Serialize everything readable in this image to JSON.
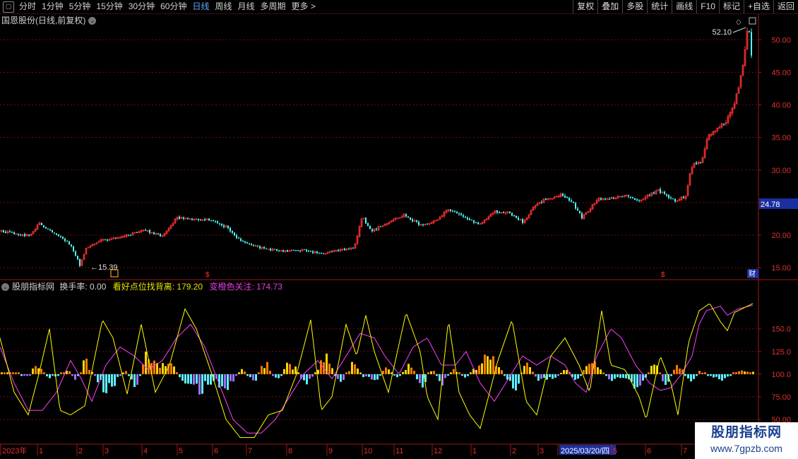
{
  "toolbar": {
    "periods": [
      "分时",
      "1分钟",
      "5分钟",
      "15分钟",
      "30分钟",
      "60分钟",
      "日线",
      "周线",
      "月线",
      "多周期",
      "更多 >"
    ],
    "active_period": "日线",
    "right_buttons": [
      "复权",
      "叠加",
      "多股",
      "统计",
      "画线",
      "F10",
      "标记",
      "+自选",
      "返回"
    ]
  },
  "stock_title": "国恩股份(日线,前复权)",
  "indicator": {
    "name": "股朋指标网",
    "turnover_label": "换手率: 0.00",
    "line1_label": "看好点位找背离: 179.20",
    "line2_label": "变橙色关注: 174.73"
  },
  "price_axis": {
    "ticks": [
      "50.00",
      "45.00",
      "40.00",
      "35.00",
      "30.00",
      "25.00",
      "20.00",
      "15.00"
    ],
    "current_price": "24.78",
    "ymin": 13.5,
    "ymax": 53.5
  },
  "indicator_axis": {
    "ticks": [
      "150.0",
      "125.0",
      "100.0",
      "75.00",
      "50.00"
    ],
    "ymin": 25,
    "ymax": 195
  },
  "annotations": {
    "high_label": "52.10",
    "low_label": "15.39",
    "cai_label": "财"
  },
  "time_axis": {
    "labels": [
      "2023年",
      "1",
      "2",
      "3",
      "4",
      "5",
      "6",
      "7",
      "8",
      "9",
      "10",
      "11",
      "12",
      "1",
      "2",
      "3",
      "2025/03/20/四",
      "5",
      "6",
      "7"
    ],
    "highlight": "2025/03/20/四"
  },
  "watermark": {
    "line1": "股朋指标网",
    "line2": "www.7gpzb.com"
  },
  "colors": {
    "up": "#ff3232",
    "down": "#54ffff",
    "grid": "#6a1010",
    "yellow_line": "#ffff00",
    "magenta_line": "#ff40ff",
    "bar_yellow": "#ffd800",
    "bar_orange": "#ff7a00",
    "bar_cyan": "#5ef0ff",
    "bar_violet": "#a070ff"
  },
  "chart_data": {
    "type": "candlestick",
    "price_keypoints": [
      [
        0,
        20.6
      ],
      [
        20,
        20.2
      ],
      [
        40,
        19.9
      ],
      [
        55,
        21.8
      ],
      [
        70,
        20.8
      ],
      [
        85,
        19.8
      ],
      [
        100,
        18.4
      ],
      [
        112,
        15.4
      ],
      [
        122,
        18.2
      ],
      [
        140,
        19.2
      ],
      [
        170,
        19.6
      ],
      [
        200,
        20.8
      ],
      [
        230,
        19.9
      ],
      [
        250,
        22.7
      ],
      [
        275,
        22.4
      ],
      [
        300,
        22.3
      ],
      [
        320,
        21.2
      ],
      [
        340,
        19.0
      ],
      [
        370,
        18.0
      ],
      [
        400,
        17.6
      ],
      [
        430,
        17.7
      ],
      [
        455,
        17.1
      ],
      [
        480,
        17.7
      ],
      [
        500,
        17.9
      ],
      [
        512,
        22.8
      ],
      [
        525,
        20.6
      ],
      [
        545,
        21.7
      ],
      [
        570,
        23.1
      ],
      [
        595,
        21.5
      ],
      [
        615,
        22.2
      ],
      [
        635,
        24.0
      ],
      [
        642,
        23.7
      ],
      [
        660,
        22.4
      ],
      [
        678,
        21.7
      ],
      [
        700,
        23.6
      ],
      [
        720,
        23.4
      ],
      [
        740,
        22.0
      ],
      [
        760,
        25.0
      ],
      [
        792,
        26.2
      ],
      [
        810,
        25.0
      ],
      [
        823,
        22.6
      ],
      [
        845,
        25.5
      ],
      [
        870,
        25.6
      ],
      [
        885,
        26.2
      ],
      [
        905,
        25.3
      ],
      [
        930,
        26.9
      ],
      [
        955,
        25.3
      ],
      [
        970,
        26.0
      ],
      [
        978,
        30.6
      ],
      [
        992,
        31.3
      ],
      [
        1002,
        35.2
      ],
      [
        1015,
        36.5
      ],
      [
        1028,
        37.5
      ],
      [
        1040,
        40.5
      ],
      [
        1050,
        45.5
      ],
      [
        1056,
        50.5
      ],
      [
        1059,
        51.8
      ],
      [
        1063,
        48.0
      ]
    ],
    "turnover_keypoints": [
      [
        0,
        0
      ],
      [
        20,
        2
      ],
      [
        40,
        -4
      ],
      [
        50,
        20
      ],
      [
        65,
        -5
      ],
      [
        80,
        -3
      ],
      [
        95,
        6
      ],
      [
        105,
        -8
      ],
      [
        120,
        18
      ],
      [
        140,
        -15
      ],
      [
        155,
        -20
      ],
      [
        175,
        8
      ],
      [
        190,
        -18
      ],
      [
        205,
        20
      ],
      [
        220,
        12
      ],
      [
        240,
        14
      ],
      [
        260,
        -12
      ],
      [
        280,
        -20
      ],
      [
        300,
        -10
      ],
      [
        320,
        -18
      ],
      [
        340,
        6
      ],
      [
        360,
        -8
      ],
      [
        375,
        18
      ],
      [
        390,
        -10
      ],
      [
        410,
        18
      ],
      [
        430,
        -14
      ],
      [
        440,
        -4
      ],
      [
        460,
        22
      ],
      [
        480,
        -12
      ],
      [
        500,
        15
      ],
      [
        515,
        -6
      ],
      [
        530,
        -10
      ],
      [
        545,
        8
      ],
      [
        560,
        -6
      ],
      [
        580,
        15
      ],
      [
        595,
        -20
      ],
      [
        610,
        10
      ],
      [
        625,
        -12
      ],
      [
        640,
        6
      ],
      [
        660,
        -6
      ],
      [
        680,
        18
      ],
      [
        700,
        16
      ],
      [
        715,
        -4
      ],
      [
        730,
        -18
      ],
      [
        745,
        25
      ],
      [
        760,
        -10
      ],
      [
        780,
        -8
      ],
      [
        800,
        8
      ],
      [
        815,
        -10
      ],
      [
        835,
        18
      ],
      [
        850,
        6
      ],
      [
        865,
        -10
      ],
      [
        880,
        -6
      ],
      [
        900,
        -14
      ],
      [
        915,
        -4
      ],
      [
        925,
        20
      ],
      [
        940,
        -14
      ],
      [
        960,
        14
      ],
      [
        975,
        -10
      ],
      [
        990,
        4
      ],
      [
        1020,
        -8
      ],
      [
        1045,
        4
      ],
      [
        1066,
        2
      ]
    ],
    "line1_keypoints": [
      [
        0,
        140
      ],
      [
        20,
        80
      ],
      [
        40,
        55
      ],
      [
        55,
        100
      ],
      [
        70,
        150
      ],
      [
        85,
        60
      ],
      [
        100,
        55
      ],
      [
        120,
        65
      ],
      [
        145,
        160
      ],
      [
        160,
        140
      ],
      [
        180,
        78
      ],
      [
        200,
        155
      ],
      [
        220,
        80
      ],
      [
        240,
        110
      ],
      [
        262,
        172
      ],
      [
        278,
        150
      ],
      [
        300,
        100
      ],
      [
        320,
        50
      ],
      [
        340,
        30
      ],
      [
        360,
        30
      ],
      [
        380,
        55
      ],
      [
        400,
        60
      ],
      [
        420,
        100
      ],
      [
        440,
        160
      ],
      [
        455,
        60
      ],
      [
        470,
        75
      ],
      [
        490,
        155
      ],
      [
        505,
        120
      ],
      [
        518,
        165
      ],
      [
        530,
        125
      ],
      [
        550,
        80
      ],
      [
        575,
        168
      ],
      [
        595,
        125
      ],
      [
        605,
        75
      ],
      [
        620,
        50
      ],
      [
        635,
        160
      ],
      [
        650,
        80
      ],
      [
        665,
        55
      ],
      [
        680,
        40
      ],
      [
        705,
        115
      ],
      [
        725,
        160
      ],
      [
        745,
        70
      ],
      [
        760,
        55
      ],
      [
        780,
        120
      ],
      [
        800,
        140
      ],
      [
        820,
        110
      ],
      [
        835,
        80
      ],
      [
        852,
        170
      ],
      [
        865,
        110
      ],
      [
        885,
        105
      ],
      [
        905,
        75
      ],
      [
        915,
        50
      ],
      [
        935,
        120
      ],
      [
        950,
        90
      ],
      [
        960,
        55
      ],
      [
        975,
        135
      ],
      [
        990,
        170
      ],
      [
        1005,
        178
      ],
      [
        1020,
        158
      ],
      [
        1030,
        148
      ],
      [
        1040,
        168
      ],
      [
        1066,
        178
      ]
    ],
    "line2_keypoints": [
      [
        0,
        130
      ],
      [
        20,
        90
      ],
      [
        40,
        60
      ],
      [
        60,
        60
      ],
      [
        80,
        80
      ],
      [
        100,
        115
      ],
      [
        115,
        95
      ],
      [
        130,
        70
      ],
      [
        150,
        110
      ],
      [
        170,
        130
      ],
      [
        190,
        120
      ],
      [
        210,
        105
      ],
      [
        230,
        115
      ],
      [
        250,
        140
      ],
      [
        270,
        155
      ],
      [
        290,
        130
      ],
      [
        310,
        90
      ],
      [
        330,
        50
      ],
      [
        350,
        35
      ],
      [
        370,
        35
      ],
      [
        390,
        50
      ],
      [
        410,
        75
      ],
      [
        430,
        100
      ],
      [
        450,
        115
      ],
      [
        470,
        95
      ],
      [
        490,
        120
      ],
      [
        510,
        145
      ],
      [
        530,
        140
      ],
      [
        545,
        120
      ],
      [
        565,
        100
      ],
      [
        585,
        130
      ],
      [
        605,
        140
      ],
      [
        625,
        110
      ],
      [
        645,
        110
      ],
      [
        660,
        125
      ],
      [
        680,
        90
      ],
      [
        700,
        70
      ],
      [
        720,
        95
      ],
      [
        740,
        120
      ],
      [
        760,
        110
      ],
      [
        780,
        120
      ],
      [
        800,
        110
      ],
      [
        815,
        90
      ],
      [
        830,
        80
      ],
      [
        845,
        120
      ],
      [
        865,
        150
      ],
      [
        880,
        140
      ],
      [
        900,
        110
      ],
      [
        920,
        90
      ],
      [
        935,
        82
      ],
      [
        950,
        85
      ],
      [
        965,
        100
      ],
      [
        980,
        120
      ],
      [
        990,
        155
      ],
      [
        1000,
        170
      ],
      [
        1020,
        175
      ],
      [
        1030,
        165
      ],
      [
        1045,
        172
      ],
      [
        1066,
        176
      ]
    ]
  }
}
